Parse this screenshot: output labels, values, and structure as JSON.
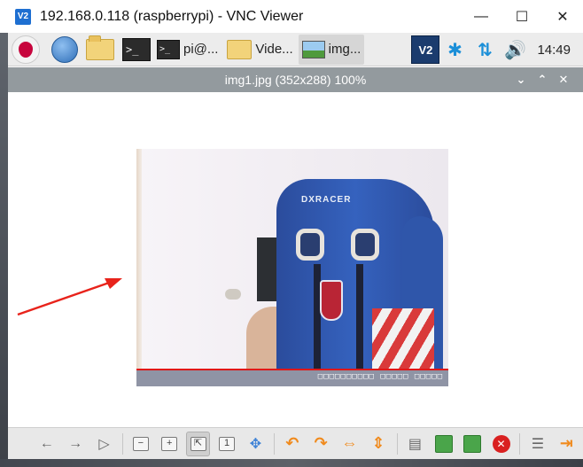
{
  "vnc_window": {
    "logo_text": "V2",
    "title": "192.168.0.118 (raspberrypi) - VNC Viewer",
    "controls": {
      "minimize": "—",
      "maximize": "☐",
      "close": "✕"
    }
  },
  "taskbar": {
    "term_glyph": ">_",
    "tasks": [
      {
        "icon": "terminal-icon",
        "label": "pi@..."
      },
      {
        "icon": "folder-icon",
        "label": "Vide..."
      },
      {
        "icon": "image-icon",
        "label": "img..."
      }
    ],
    "vnc_tray_text": "V2",
    "tray": {
      "bluetooth": "✱",
      "network": "⇅",
      "volume": "🔊"
    },
    "clock": "14:49"
  },
  "viewer": {
    "title": "img1.jpg (352x288) 100%",
    "controls": {
      "menu": "⌄",
      "maximize": "⌃",
      "close": "✕"
    },
    "photo": {
      "brand_text": "DXRACER",
      "caption": "□□□□□□□□□□ □□□□□ □□□□□"
    },
    "toolbar_glyphs": {
      "back": "←",
      "forward": "→",
      "play": "▷",
      "zoom_out": "−",
      "zoom_in": "+",
      "fit": "⇱",
      "original": "1",
      "fullscreen": "✥",
      "rotate_left": "↶",
      "rotate_right": "↷",
      "flip_h": "⇔",
      "flip_v": "⇕",
      "open": "▤",
      "save": "⬇",
      "save_as": "⬇",
      "delete": "✕",
      "preferences": "☰",
      "quit": "⇥"
    }
  },
  "colors": {
    "viewer_titlebar": "#939a9e",
    "annotation_arrow": "#e8231b",
    "accent_blue": "#1b8fd8"
  }
}
